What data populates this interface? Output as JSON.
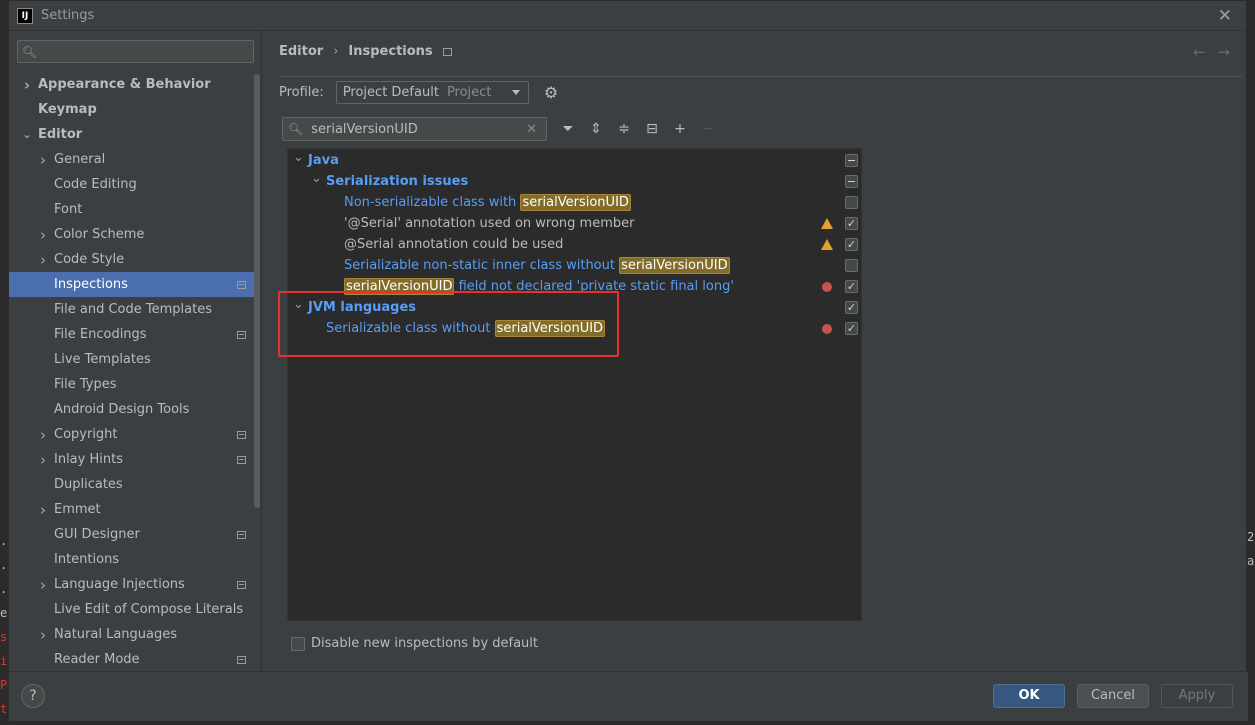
{
  "window": {
    "title": "Settings",
    "app_icon_text": "IJ"
  },
  "sidebar": {
    "search_placeholder": "",
    "items": [
      {
        "label": "Appearance & Behavior",
        "level": 0,
        "bold": true,
        "expandable": true,
        "expanded": false
      },
      {
        "label": "Keymap",
        "level": 0,
        "bold": true
      },
      {
        "label": "Editor",
        "level": 0,
        "bold": true,
        "expandable": true,
        "expanded": true
      },
      {
        "label": "General",
        "level": 1,
        "expandable": true
      },
      {
        "label": "Code Editing",
        "level": 1
      },
      {
        "label": "Font",
        "level": 1
      },
      {
        "label": "Color Scheme",
        "level": 1,
        "expandable": true
      },
      {
        "label": "Code Style",
        "level": 1,
        "expandable": true
      },
      {
        "label": "Inspections",
        "level": 1,
        "selected": true,
        "modified": true
      },
      {
        "label": "File and Code Templates",
        "level": 1
      },
      {
        "label": "File Encodings",
        "level": 1,
        "modified": true
      },
      {
        "label": "Live Templates",
        "level": 1
      },
      {
        "label": "File Types",
        "level": 1
      },
      {
        "label": "Android Design Tools",
        "level": 1
      },
      {
        "label": "Copyright",
        "level": 1,
        "expandable": true,
        "modified": true
      },
      {
        "label": "Inlay Hints",
        "level": 1,
        "expandable": true,
        "modified": true
      },
      {
        "label": "Duplicates",
        "level": 1
      },
      {
        "label": "Emmet",
        "level": 1,
        "expandable": true
      },
      {
        "label": "GUI Designer",
        "level": 1,
        "modified": true
      },
      {
        "label": "Intentions",
        "level": 1
      },
      {
        "label": "Language Injections",
        "level": 1,
        "expandable": true,
        "modified": true
      },
      {
        "label": "Live Edit of Compose Literals",
        "level": 1
      },
      {
        "label": "Natural Languages",
        "level": 1,
        "expandable": true
      },
      {
        "label": "Reader Mode",
        "level": 1,
        "modified": true
      }
    ]
  },
  "breadcrumb": {
    "part1": "Editor",
    "separator": "›",
    "part2": "Inspections"
  },
  "profile": {
    "label": "Profile:",
    "value": "Project Default",
    "sub": "Project"
  },
  "filter": {
    "value": "serialVersionUID"
  },
  "inspections": {
    "highlight": "serialVersionUID",
    "rows": [
      {
        "type": "group",
        "level": 0,
        "text": "Java",
        "check": "partial"
      },
      {
        "type": "group",
        "level": 1,
        "text": "Serialization issues",
        "check": "partial"
      },
      {
        "type": "item",
        "level": 2,
        "pre": "Non-serializable class with ",
        "hl": "serialVersionUID",
        "post": "",
        "color": "blue",
        "check": "off",
        "severity": ""
      },
      {
        "type": "item",
        "level": 2,
        "pre": "'@Serial' annotation used on wrong member",
        "hl": "",
        "post": "",
        "color": "gray",
        "check": "on",
        "severity": "warning"
      },
      {
        "type": "item",
        "level": 2,
        "pre": "@Serial annotation could be used",
        "hl": "",
        "post": "",
        "color": "gray",
        "check": "on",
        "severity": "warning"
      },
      {
        "type": "item",
        "level": 2,
        "pre": "Serializable non-static inner class without ",
        "hl": "serialVersionUID",
        "post": "",
        "color": "blue",
        "check": "off",
        "severity": ""
      },
      {
        "type": "item",
        "level": 2,
        "pre": "",
        "hl": "serialVersionUID",
        "post": " field not declared 'private static final long'",
        "color": "blue",
        "check": "on",
        "severity": "error"
      },
      {
        "type": "group",
        "level": 0,
        "text": "JVM languages",
        "check": "on"
      },
      {
        "type": "item",
        "level": 1,
        "pre": "Serializable class without ",
        "hl": "serialVersionUID",
        "post": "",
        "color": "blue",
        "check": "on",
        "severity": "error"
      }
    ]
  },
  "disable_new": {
    "label": "Disable new inspections by default"
  },
  "footer": {
    "help": "?",
    "ok": "OK",
    "cancel": "Cancel",
    "apply": "Apply"
  },
  "background": {
    "lines": [
      ".",
      ".",
      ".",
      "e",
      "s",
      "i",
      "P",
      "t"
    ],
    "right_lines": [
      "2",
      "a"
    ]
  },
  "colors": {
    "accent": "#4b6eaf",
    "link_blue": "#589df6",
    "highlight": "#826c2a",
    "annotation_red": "#e8302e"
  }
}
